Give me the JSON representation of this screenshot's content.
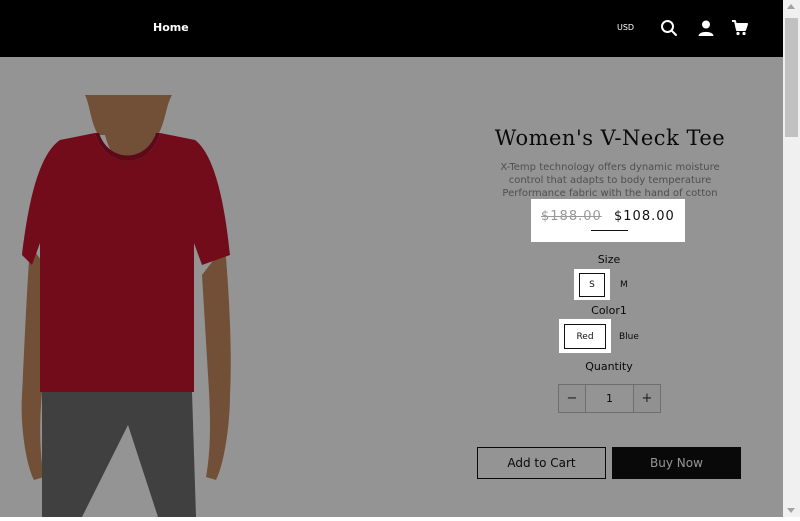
{
  "header": {
    "nav_home": "Home",
    "currency": "USD",
    "icons": [
      "search-icon",
      "account-icon",
      "cart-icon"
    ]
  },
  "product": {
    "title": "Women's V-Neck Tee",
    "description": [
      "X-Temp technology offers dynamic moisture",
      "control that adapts to body temperature",
      "Performance fabric with the hand of cotton"
    ],
    "price_original": "$188.00",
    "price_sale": "$108.00",
    "size_label": "Size",
    "sizes": [
      "S",
      "M"
    ],
    "selected_size": "S",
    "color_label": "Color1",
    "colors": [
      "Red",
      "Blue"
    ],
    "selected_color": "Red",
    "quantity_label": "Quantity",
    "quantity": "1",
    "qty_minus": "−",
    "qty_plus": "+",
    "add_to_cart": "Add to Cart",
    "buy_now": "Buy Now",
    "shirt_color": "#c4152f",
    "pants_color": "#6e6e6e"
  },
  "colors": {
    "header_bg": "#000000",
    "overlay": "rgba(0,0,0,0.42)",
    "buy_now_bg": "#111111"
  }
}
